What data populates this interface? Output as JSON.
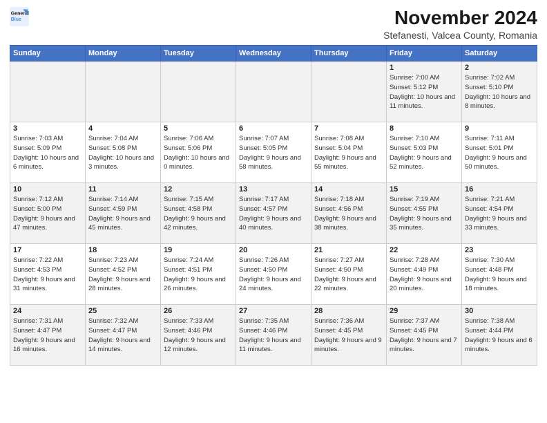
{
  "header": {
    "logo_line1": "General",
    "logo_line2": "Blue",
    "title": "November 2024",
    "subtitle": "Stefanesti, Valcea County, Romania"
  },
  "weekdays": [
    "Sunday",
    "Monday",
    "Tuesday",
    "Wednesday",
    "Thursday",
    "Friday",
    "Saturday"
  ],
  "weeks": [
    [
      {
        "day": "",
        "info": ""
      },
      {
        "day": "",
        "info": ""
      },
      {
        "day": "",
        "info": ""
      },
      {
        "day": "",
        "info": ""
      },
      {
        "day": "",
        "info": ""
      },
      {
        "day": "1",
        "info": "Sunrise: 7:00 AM\nSunset: 5:12 PM\nDaylight: 10 hours and 11 minutes."
      },
      {
        "day": "2",
        "info": "Sunrise: 7:02 AM\nSunset: 5:10 PM\nDaylight: 10 hours and 8 minutes."
      }
    ],
    [
      {
        "day": "3",
        "info": "Sunrise: 7:03 AM\nSunset: 5:09 PM\nDaylight: 10 hours and 6 minutes."
      },
      {
        "day": "4",
        "info": "Sunrise: 7:04 AM\nSunset: 5:08 PM\nDaylight: 10 hours and 3 minutes."
      },
      {
        "day": "5",
        "info": "Sunrise: 7:06 AM\nSunset: 5:06 PM\nDaylight: 10 hours and 0 minutes."
      },
      {
        "day": "6",
        "info": "Sunrise: 7:07 AM\nSunset: 5:05 PM\nDaylight: 9 hours and 58 minutes."
      },
      {
        "day": "7",
        "info": "Sunrise: 7:08 AM\nSunset: 5:04 PM\nDaylight: 9 hours and 55 minutes."
      },
      {
        "day": "8",
        "info": "Sunrise: 7:10 AM\nSunset: 5:03 PM\nDaylight: 9 hours and 52 minutes."
      },
      {
        "day": "9",
        "info": "Sunrise: 7:11 AM\nSunset: 5:01 PM\nDaylight: 9 hours and 50 minutes."
      }
    ],
    [
      {
        "day": "10",
        "info": "Sunrise: 7:12 AM\nSunset: 5:00 PM\nDaylight: 9 hours and 47 minutes."
      },
      {
        "day": "11",
        "info": "Sunrise: 7:14 AM\nSunset: 4:59 PM\nDaylight: 9 hours and 45 minutes."
      },
      {
        "day": "12",
        "info": "Sunrise: 7:15 AM\nSunset: 4:58 PM\nDaylight: 9 hours and 42 minutes."
      },
      {
        "day": "13",
        "info": "Sunrise: 7:17 AM\nSunset: 4:57 PM\nDaylight: 9 hours and 40 minutes."
      },
      {
        "day": "14",
        "info": "Sunrise: 7:18 AM\nSunset: 4:56 PM\nDaylight: 9 hours and 38 minutes."
      },
      {
        "day": "15",
        "info": "Sunrise: 7:19 AM\nSunset: 4:55 PM\nDaylight: 9 hours and 35 minutes."
      },
      {
        "day": "16",
        "info": "Sunrise: 7:21 AM\nSunset: 4:54 PM\nDaylight: 9 hours and 33 minutes."
      }
    ],
    [
      {
        "day": "17",
        "info": "Sunrise: 7:22 AM\nSunset: 4:53 PM\nDaylight: 9 hours and 31 minutes."
      },
      {
        "day": "18",
        "info": "Sunrise: 7:23 AM\nSunset: 4:52 PM\nDaylight: 9 hours and 28 minutes."
      },
      {
        "day": "19",
        "info": "Sunrise: 7:24 AM\nSunset: 4:51 PM\nDaylight: 9 hours and 26 minutes."
      },
      {
        "day": "20",
        "info": "Sunrise: 7:26 AM\nSunset: 4:50 PM\nDaylight: 9 hours and 24 minutes."
      },
      {
        "day": "21",
        "info": "Sunrise: 7:27 AM\nSunset: 4:50 PM\nDaylight: 9 hours and 22 minutes."
      },
      {
        "day": "22",
        "info": "Sunrise: 7:28 AM\nSunset: 4:49 PM\nDaylight: 9 hours and 20 minutes."
      },
      {
        "day": "23",
        "info": "Sunrise: 7:30 AM\nSunset: 4:48 PM\nDaylight: 9 hours and 18 minutes."
      }
    ],
    [
      {
        "day": "24",
        "info": "Sunrise: 7:31 AM\nSunset: 4:47 PM\nDaylight: 9 hours and 16 minutes."
      },
      {
        "day": "25",
        "info": "Sunrise: 7:32 AM\nSunset: 4:47 PM\nDaylight: 9 hours and 14 minutes."
      },
      {
        "day": "26",
        "info": "Sunrise: 7:33 AM\nSunset: 4:46 PM\nDaylight: 9 hours and 12 minutes."
      },
      {
        "day": "27",
        "info": "Sunrise: 7:35 AM\nSunset: 4:46 PM\nDaylight: 9 hours and 11 minutes."
      },
      {
        "day": "28",
        "info": "Sunrise: 7:36 AM\nSunset: 4:45 PM\nDaylight: 9 hours and 9 minutes."
      },
      {
        "day": "29",
        "info": "Sunrise: 7:37 AM\nSunset: 4:45 PM\nDaylight: 9 hours and 7 minutes."
      },
      {
        "day": "30",
        "info": "Sunrise: 7:38 AM\nSunset: 4:44 PM\nDaylight: 9 hours and 6 minutes."
      }
    ]
  ]
}
